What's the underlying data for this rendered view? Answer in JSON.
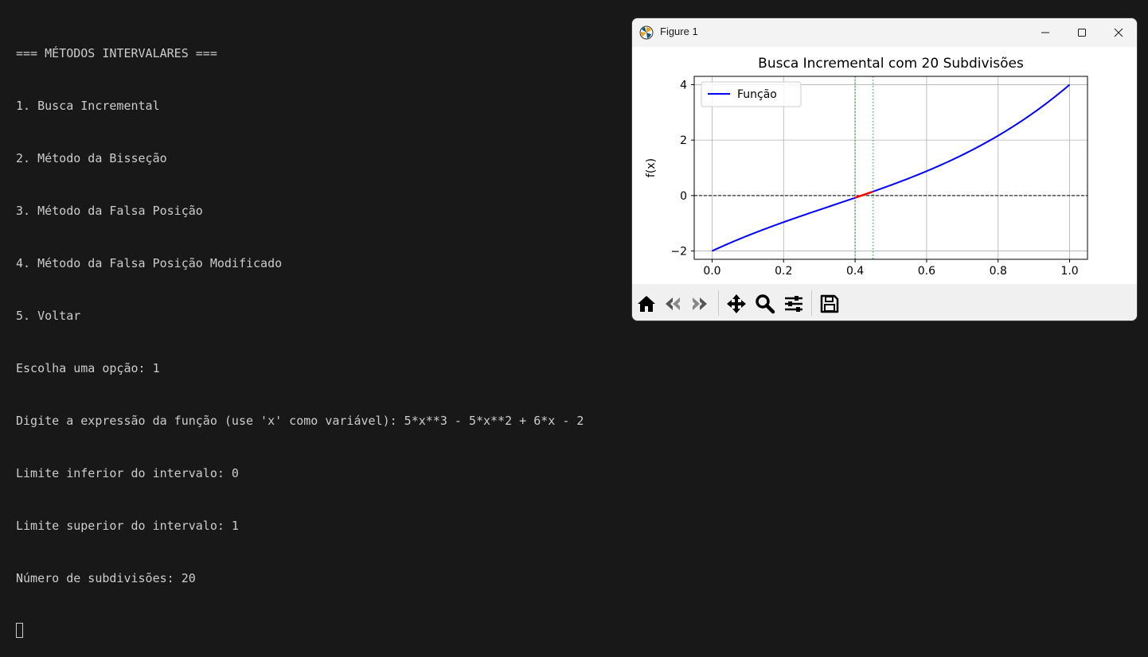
{
  "terminal": {
    "lines": [
      "=== MÉTODOS INTERVALARES ===",
      "1. Busca Incremental",
      "2. Método da Bisseção",
      "3. Método da Falsa Posição",
      "4. Método da Falsa Posição Modificado",
      "5. Voltar",
      "Escolha uma opção: 1",
      "Digite a expressão da função (use 'x' como variável): 5*x**3 - 5*x**2 + 6*x - 2",
      "Limite inferior do intervalo: 0",
      "Limite superior do intervalo: 1",
      "Número de subdivisões: 20"
    ]
  },
  "window": {
    "title": "Figure 1",
    "icons": [
      "matplotlib-icon",
      "minimize-icon",
      "maximize-icon",
      "close-icon"
    ]
  },
  "toolbar": {
    "icons": [
      "home-icon",
      "back-icon",
      "forward-icon",
      "pan-icon",
      "zoom-icon",
      "configure-subplots-icon",
      "save-icon"
    ]
  },
  "chart_data": {
    "type": "line",
    "title": "Busca Incremental com 20 Subdivisões",
    "xlabel": "",
    "ylabel": "f(x)",
    "xlim": [
      -0.05,
      1.05
    ],
    "ylim": [
      -2.3,
      4.3
    ],
    "xticks": [
      "0.0",
      "0.2",
      "0.4",
      "0.6",
      "0.8",
      "1.0"
    ],
    "xtick_values": [
      0,
      0.2,
      0.4,
      0.6,
      0.8,
      1.0
    ],
    "yticks": [
      "−2",
      "0",
      "2",
      "4"
    ],
    "ytick_values": [
      -2,
      0,
      2,
      4
    ],
    "grid": true,
    "legend": {
      "position": "top-left",
      "entries": [
        "Função"
      ]
    },
    "function": "5*x**3 - 5*x**2 + 6*x - 2",
    "series": [
      {
        "name": "Função",
        "color": "#0000ff",
        "x_range": [
          0,
          1
        ]
      }
    ],
    "root_segment": {
      "x_range": [
        0.4,
        0.45
      ],
      "color": "#ff0000"
    },
    "vlines": [
      {
        "x": 0.4,
        "color": "#2ca02c",
        "style": "dotted"
      },
      {
        "x": 0.45,
        "color": "#2ca02c",
        "style": "dotted"
      }
    ],
    "hline": {
      "y": 0,
      "color": "#000000",
      "style": "dashed"
    }
  }
}
